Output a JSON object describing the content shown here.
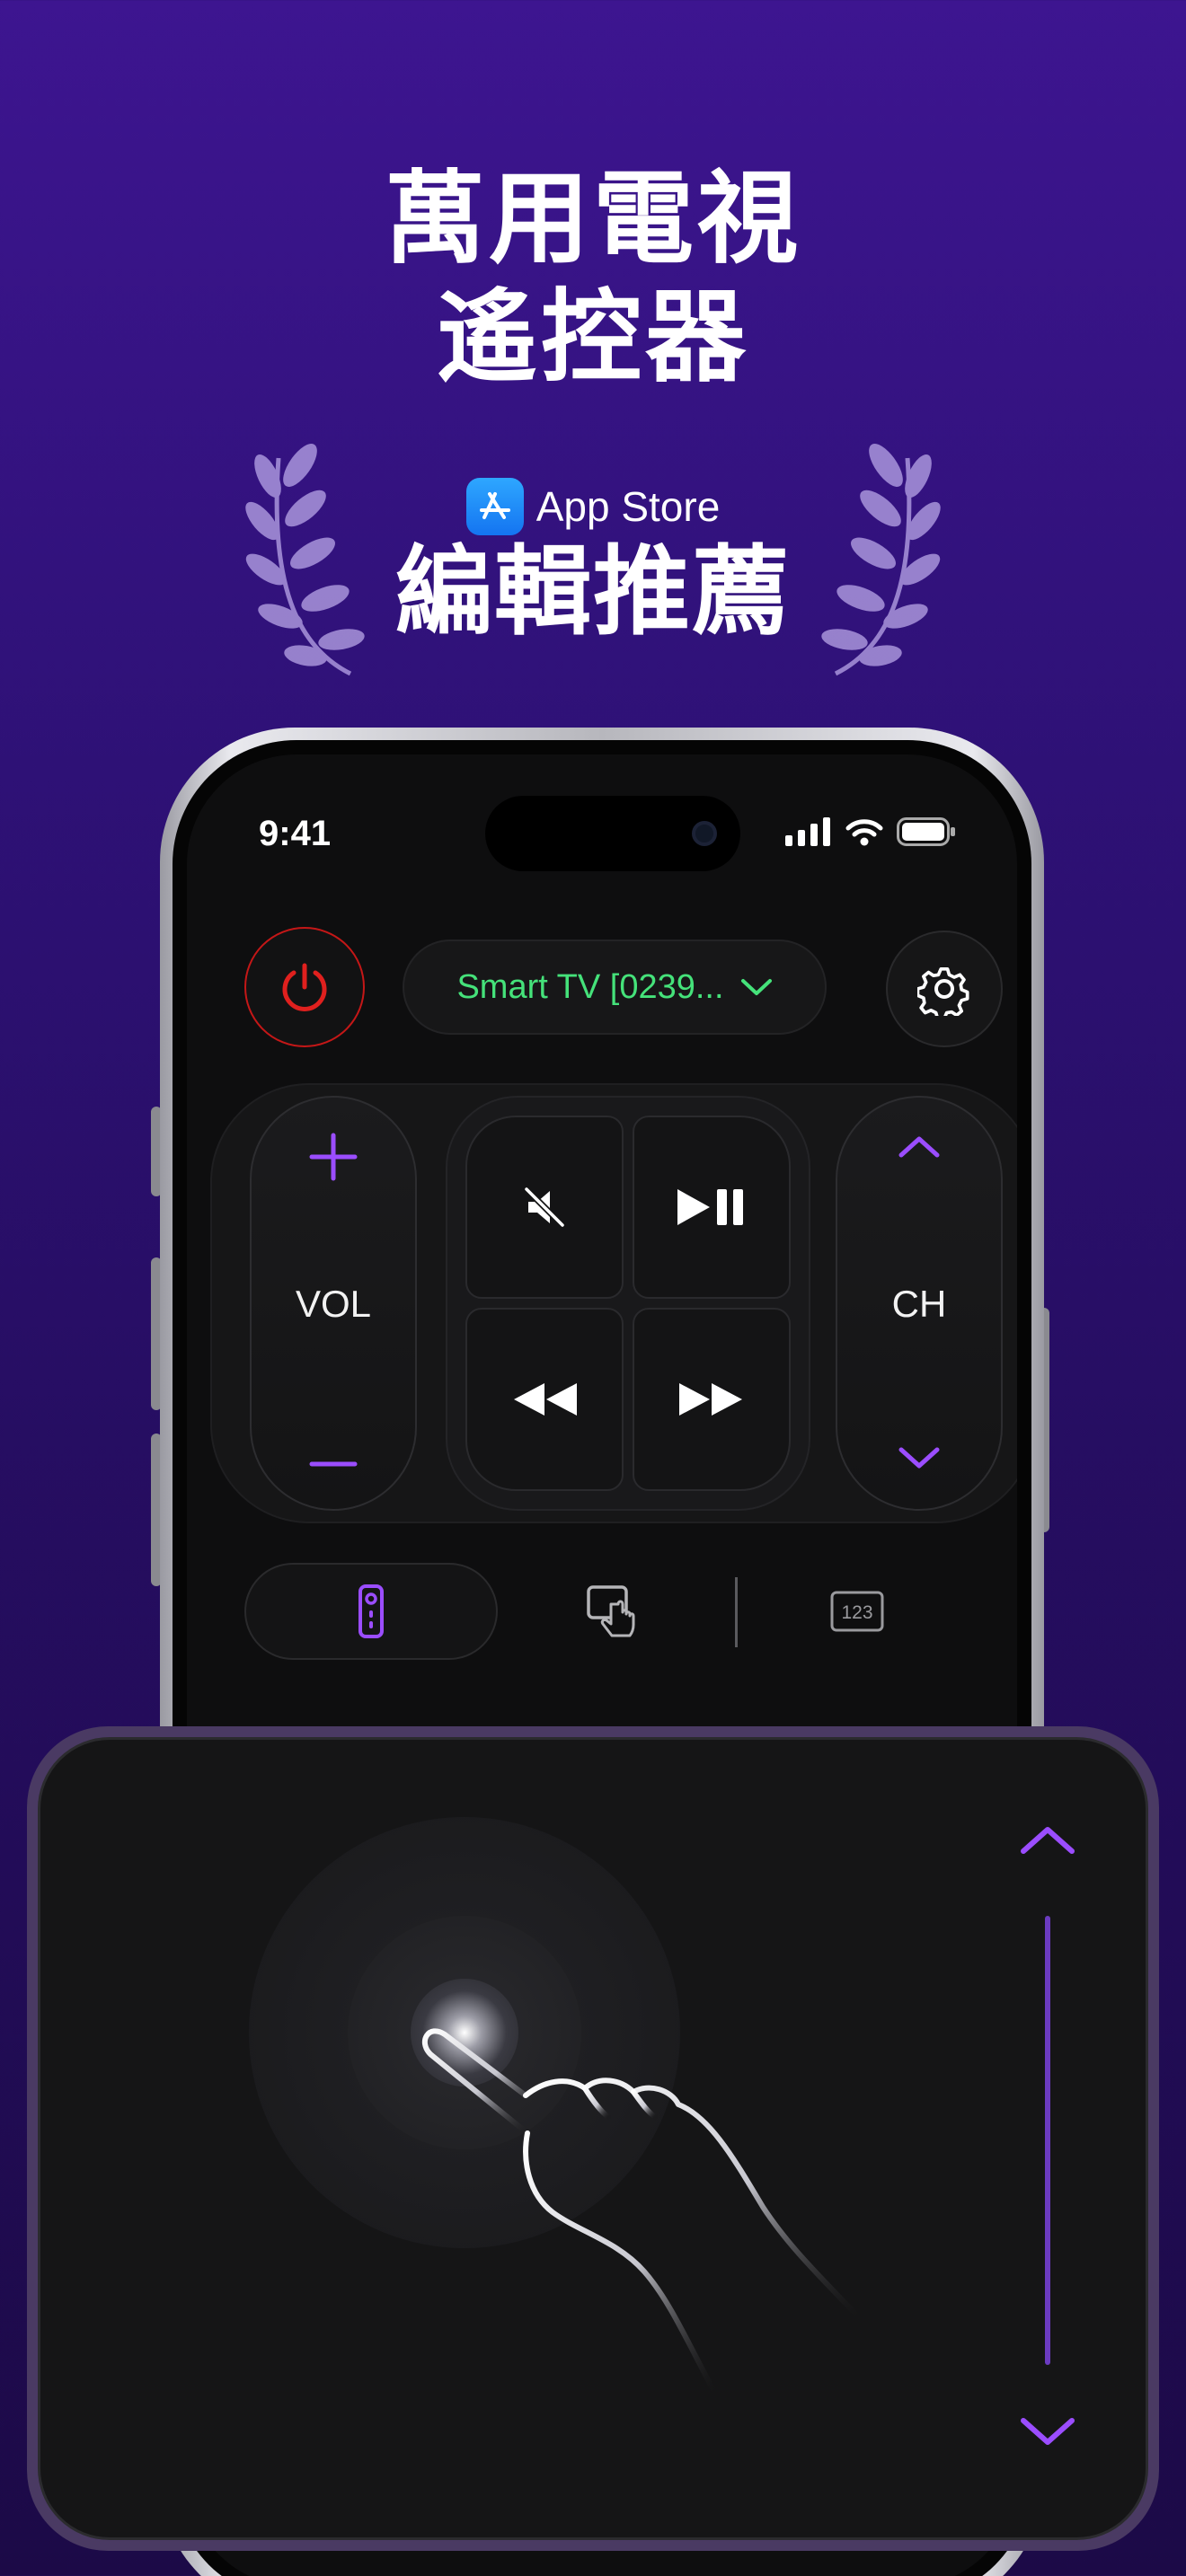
{
  "headline": {
    "line1": "萬用電視",
    "line2": "遙控器"
  },
  "award": {
    "store_label": "App Store",
    "title": "編輯推薦"
  },
  "status_bar": {
    "time": "9:41"
  },
  "remote": {
    "device_name": "Smart TV [0239...",
    "volume_label": "VOL",
    "channel_label": "CH"
  },
  "colors": {
    "accent_purple": "#9b4dff",
    "power_red": "#e0201e",
    "device_green": "#45e27a",
    "background": "#2e1176"
  },
  "icons": {
    "power": "power-icon",
    "settings": "gear-icon",
    "mute": "mute-icon",
    "play_pause": "play-pause-icon",
    "rewind": "rewind-icon",
    "fast_forward": "fast-forward-icon",
    "remote_tab": "remote-icon",
    "touchpad_tab": "touchpad-icon",
    "numpad_tab": "numpad-icon"
  },
  "numpad_tab_label": "123"
}
